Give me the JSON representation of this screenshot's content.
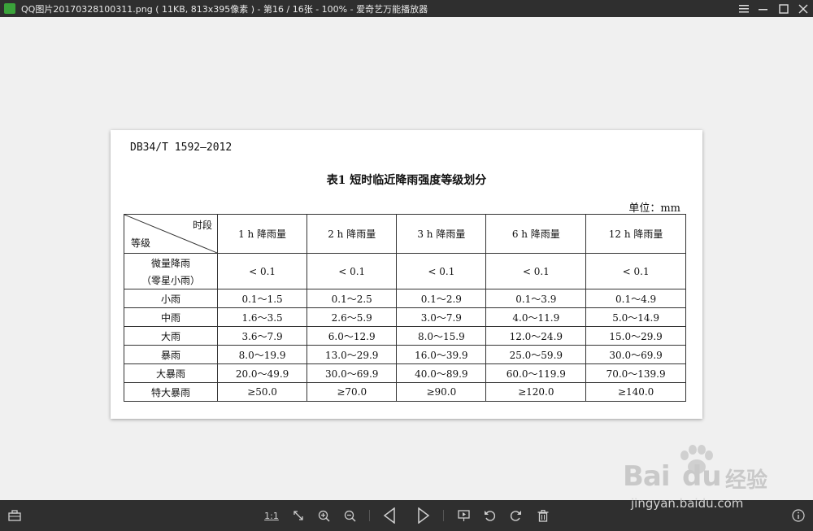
{
  "window": {
    "title": "QQ图片20170328100311.png ( 11KB, 813x395像素 ) - 第16 / 16张 - 100% - 爱奇艺万能播放器",
    "controls": [
      "menu-icon",
      "minimize-icon",
      "maximize-icon",
      "close-icon"
    ]
  },
  "document": {
    "code": "DB34/T 1592—2012",
    "table_title": "表1  短时临近降雨强度等级划分",
    "unit": "单位：mm",
    "corner_top": "时段",
    "corner_bottom": "等级",
    "columns": [
      "1 h 降雨量",
      "2 h 降雨量",
      "3 h 降雨量",
      "6 h 降雨量",
      "12 h 降雨量"
    ],
    "rows": [
      {
        "grade": "微量降雨",
        "grade_note": "（零星小雨）",
        "values": [
          "< 0.1",
          "< 0.1",
          "< 0.1",
          "< 0.1",
          "< 0.1"
        ]
      },
      {
        "grade": "小雨",
        "values": [
          "0.1～1.5",
          "0.1～2.5",
          "0.1～2.9",
          "0.1～3.9",
          "0.1～4.9"
        ]
      },
      {
        "grade": "中雨",
        "values": [
          "1.6～3.5",
          "2.6～5.9",
          "3.0～7.9",
          "4.0～11.9",
          "5.0～14.9"
        ]
      },
      {
        "grade": "大雨",
        "values": [
          "3.6～7.9",
          "6.0～12.9",
          "8.0～15.9",
          "12.0～24.9",
          "15.0～29.9"
        ]
      },
      {
        "grade": "暴雨",
        "values": [
          "8.0～19.9",
          "13.0～29.9",
          "16.0～39.9",
          "25.0～59.9",
          "30.0～69.9"
        ]
      },
      {
        "grade": "大暴雨",
        "values": [
          "20.0～49.9",
          "30.0～69.9",
          "40.0～89.9",
          "60.0～119.9",
          "70.0～139.9"
        ]
      },
      {
        "grade": "特大暴雨",
        "values": [
          "≥50.0",
          "≥70.0",
          "≥90.0",
          "≥120.0",
          "≥140.0"
        ]
      }
    ]
  },
  "toolbar": {
    "actual_size_label": "1:1",
    "icons": [
      "toolbox-icon",
      "actual-size-icon",
      "fit-window-icon",
      "zoom-in-icon",
      "zoom-out-icon",
      "previous-icon",
      "next-icon",
      "slideshow-icon",
      "rotate-left-icon",
      "rotate-right-icon",
      "delete-icon",
      "info-icon"
    ]
  },
  "watermark": {
    "brand": "Bai",
    "brand_suffix": "du",
    "brand_cn": "经验",
    "url": "jingyan.baidu.com"
  },
  "colors": {
    "chrome": "#2f2f2f",
    "canvas": "#f0f0f0",
    "app_icon": "#3aa33a"
  }
}
